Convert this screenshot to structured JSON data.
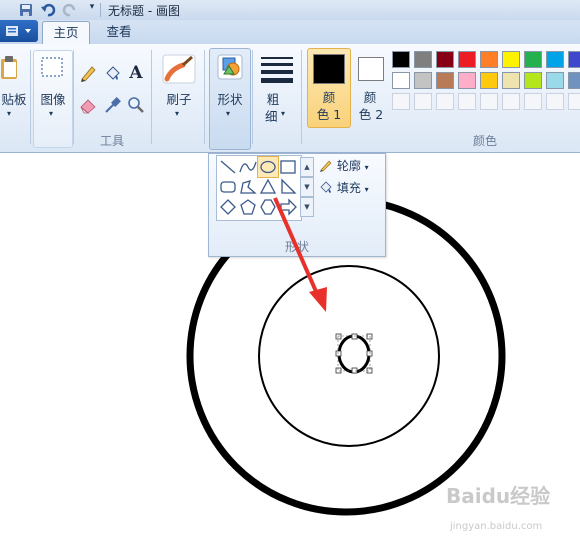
{
  "window": {
    "title": "无标题 - 画图"
  },
  "tabs": {
    "file_label": "",
    "home": "主页",
    "view": "查看"
  },
  "ribbon": {
    "clipboard_label": "贴板",
    "image_label": "图像",
    "tools_group": "工具",
    "brush_label": "刷子",
    "shapes_label": "形状",
    "size_label_1": "粗",
    "size_label_2": "细",
    "color1_label_1": "颜",
    "color1_label_2": "色 1",
    "color2_label_1": "颜",
    "color2_label_2": "色 2",
    "colors_group": "颜色"
  },
  "palette": {
    "row1": [
      "#000000",
      "#7f7f7f",
      "#880015",
      "#ed1c24",
      "#ff7f27",
      "#fff200",
      "#22b14c",
      "#00a2e8",
      "#3f48cc"
    ],
    "row2": [
      "#ffffff",
      "#c3c3c3",
      "#b97a57",
      "#ffaec9",
      "#ffc90e",
      "#efe4b0",
      "#b5e61d",
      "#99d9ea",
      "#7092be"
    ]
  },
  "color1": "#000000",
  "color2": "#ffffff",
  "shapes_dropdown": {
    "outline_label": "轮廓",
    "fill_label": "填充",
    "group_label": "形状",
    "icons": [
      "line-icon",
      "curve-icon",
      "oval-icon",
      "rectangle-icon",
      "rounded-rectangle-icon",
      "polygon-icon",
      "triangle-icon",
      "right-triangle-icon",
      "diamond-icon",
      "pentagon-icon",
      "hexagon-icon",
      "right-arrow-icon"
    ],
    "selected": "oval-icon"
  },
  "watermark": {
    "brand": "Baidu经验",
    "url": "jingyan.baidu.com"
  },
  "accent": "#e8312a"
}
